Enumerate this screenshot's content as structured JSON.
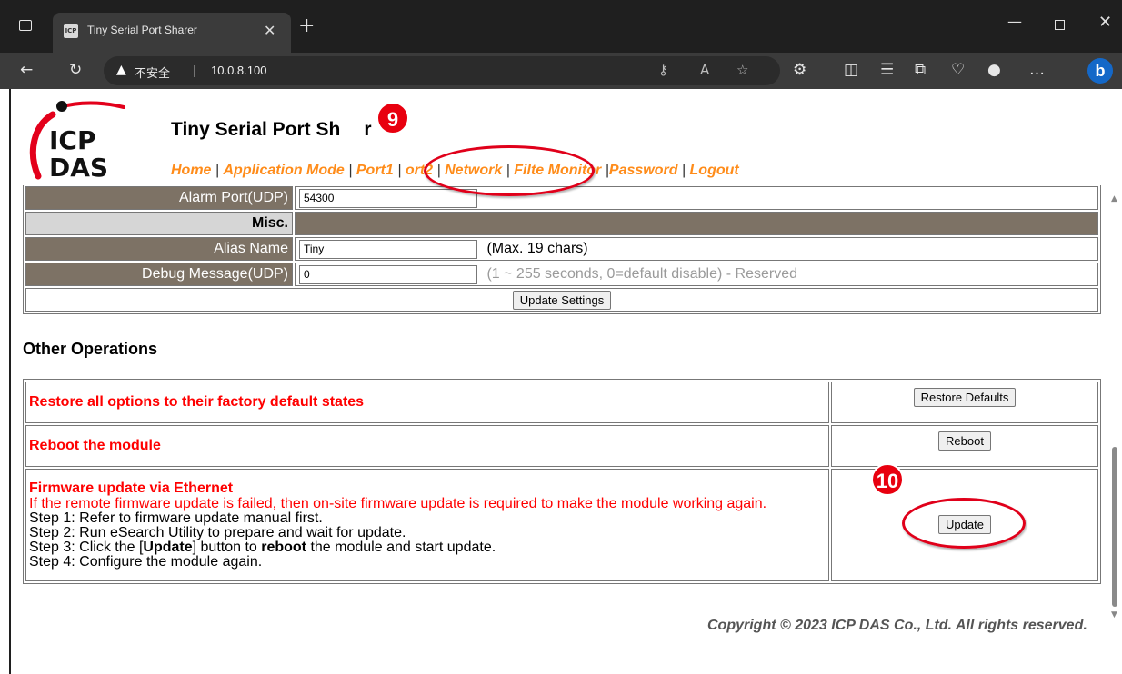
{
  "browser": {
    "tab_title": "Tiny Serial Port Sharer",
    "tab_favicon": "favicon-icon",
    "insecure_label": "不安全",
    "url": "10.0.8.100",
    "icons": [
      "tab-list-icon",
      "close-icon",
      "plus-icon",
      "minimize-icon",
      "maximize-icon",
      "back-icon",
      "refresh-icon",
      "warning-icon",
      "key-icon",
      "read-aloud-icon",
      "star-icon",
      "extensions-icon",
      "split-screen-icon",
      "favorites-icon",
      "collections-icon",
      "performance-icon",
      "profile-icon",
      "more-icon",
      "bing-icon"
    ]
  },
  "header": {
    "logo_text_top": "ICP",
    "logo_text_bottom": "DAS",
    "title": "Tiny Serial Port Sh",
    "title_tail": "r",
    "nav": [
      "Home",
      "Application Mode",
      "Port1",
      "Port2",
      "Network",
      "Filter",
      "Monitor",
      "Password",
      "Logout"
    ],
    "nav_display": {
      "port2": "ort2",
      "filter": "Filte",
      "monitor": "Monitor"
    }
  },
  "settings": {
    "alarm_port_label": "Alarm Port(UDP)",
    "alarm_port_value": "54300",
    "misc_label": "Misc.",
    "alias_label": "Alias Name",
    "alias_value": "Tiny",
    "alias_note": "(Max. 19 chars)",
    "debug_label": "Debug Message(UDP)",
    "debug_value": "0",
    "debug_note": "(1 ~ 255 seconds, 0=default disable) - Reserved",
    "update_settings_label": "Update Settings"
  },
  "other": {
    "title": "Other Operations",
    "restore_text": "Restore all options to their factory default states",
    "restore_button": "Restore Defaults",
    "reboot_text": "Reboot the module",
    "reboot_button": "Reboot",
    "fw_title": "Firmware update via Ethernet",
    "fw_warning": "If the remote firmware update is failed, then on-site firmware update is required to make the module working again.",
    "fw_step1": "Step 1: Refer to firmware update manual first.",
    "fw_step2": "Step 2: Run eSearch Utility to prepare and wait for update.",
    "fw_step3_a": "Step 3: Click the [",
    "fw_step3_b": "Update",
    "fw_step3_c": "] button to ",
    "fw_step3_d": "reboot",
    "fw_step3_e": " the module and start update.",
    "fw_step4": "Step 4: Configure the module again.",
    "update_button": "Update"
  },
  "footer": {
    "copyright": "Copyright © 2023 ICP DAS Co., Ltd. All rights reserved."
  },
  "annotations": {
    "badge_9": "9",
    "badge_10": "10"
  },
  "colors": {
    "nav": "#ff8c1a",
    "label_bg": "#7d7265",
    "alert_red": "#ff0000",
    "annotation_red": "#e8000f"
  }
}
